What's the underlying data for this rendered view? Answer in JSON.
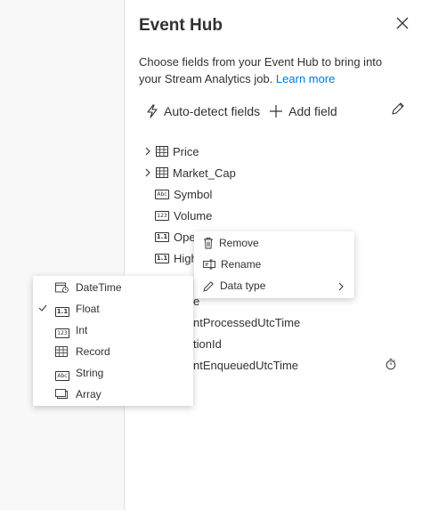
{
  "panel": {
    "title": "Event Hub",
    "description": "Choose fields from your Event Hub to bring into your Stream Analytics job.",
    "learn_more": "Learn more"
  },
  "toolbar": {
    "autodetect_label": "Auto-detect fields",
    "add_field_label": "Add field"
  },
  "fields": [
    {
      "name": "Price",
      "type_icon": "table-icon",
      "expandable": true
    },
    {
      "name": "Market_Cap",
      "type_icon": "table-icon",
      "expandable": true
    },
    {
      "name": "Symbol",
      "type_icon": "string-icon",
      "badge": "Abc"
    },
    {
      "name": "Volume",
      "type_icon": "int-icon",
      "badge": "123"
    },
    {
      "name": "Ope",
      "type_icon": "float-icon",
      "badge": "1.1"
    },
    {
      "name": "High",
      "type_icon": "float-icon",
      "badge": "1.1"
    },
    {
      "name": "e",
      "type_icon": "none"
    },
    {
      "name": "ntProcessedUtcTime",
      "type_icon": "none"
    },
    {
      "name": "tionId",
      "type_icon": "none"
    },
    {
      "name": "ntEnqueuedUtcTime",
      "type_icon": "none",
      "trailing_icon": "timer-icon"
    }
  ],
  "context_menu": {
    "remove": "Remove",
    "rename": "Rename",
    "data_type": "Data type"
  },
  "type_menu": {
    "items": [
      {
        "label": "DateTime",
        "icon": "datetime-icon",
        "checked": false
      },
      {
        "label": "Float",
        "icon": "float-icon",
        "badge": "1.1",
        "checked": true
      },
      {
        "label": "Int",
        "icon": "int-icon",
        "badge": "123",
        "checked": false
      },
      {
        "label": "Record",
        "icon": "table-icon",
        "checked": false
      },
      {
        "label": "String",
        "icon": "string-icon",
        "badge": "Abc",
        "checked": false
      },
      {
        "label": "Array",
        "icon": "array-icon",
        "checked": false
      }
    ]
  },
  "colors": {
    "link": "#0078d4",
    "text": "#323130",
    "background": "#f8f8f8"
  }
}
